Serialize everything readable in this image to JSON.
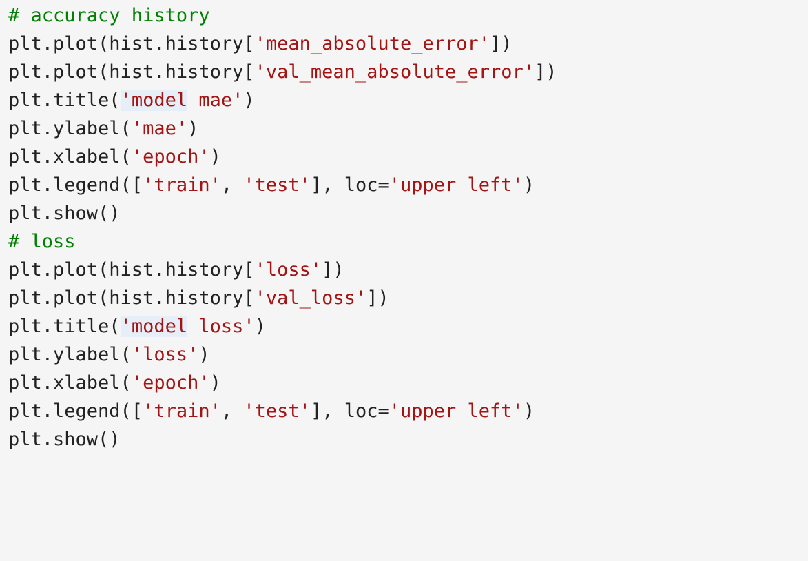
{
  "code": {
    "language": "python",
    "colors": {
      "background": "#f5f5f5",
      "plain": "#222222",
      "string": "#a31515",
      "comment": "#008000",
      "selection_highlight": "#e6eef8"
    },
    "lines": [
      [
        {
          "t": "comment",
          "v": "# accuracy history"
        }
      ],
      [
        {
          "t": "plain",
          "v": "plt.plot(hist.history["
        },
        {
          "t": "string",
          "v": "'mean_absolute_error'"
        },
        {
          "t": "plain",
          "v": "])"
        }
      ],
      [
        {
          "t": "plain",
          "v": "plt.plot(hist.history["
        },
        {
          "t": "string",
          "v": "'val_mean_absolute_error'"
        },
        {
          "t": "plain",
          "v": "])"
        }
      ],
      [
        {
          "t": "plain",
          "v": "plt.title("
        },
        {
          "t": "string",
          "v": "'model",
          "hl": true
        },
        {
          "t": "string",
          "v": " mae'"
        },
        {
          "t": "plain",
          "v": ")"
        }
      ],
      [
        {
          "t": "plain",
          "v": "plt.ylabel("
        },
        {
          "t": "string",
          "v": "'mae'"
        },
        {
          "t": "plain",
          "v": ")"
        }
      ],
      [
        {
          "t": "plain",
          "v": "plt.xlabel("
        },
        {
          "t": "string",
          "v": "'epoch'"
        },
        {
          "t": "plain",
          "v": ")"
        }
      ],
      [
        {
          "t": "plain",
          "v": "plt.legend(["
        },
        {
          "t": "string",
          "v": "'train'"
        },
        {
          "t": "plain",
          "v": ", "
        },
        {
          "t": "string",
          "v": "'test'"
        },
        {
          "t": "plain",
          "v": "], loc="
        },
        {
          "t": "string",
          "v": "'upper left'"
        },
        {
          "t": "plain",
          "v": ")"
        }
      ],
      [
        {
          "t": "plain",
          "v": "plt.show()"
        }
      ],
      [
        {
          "t": "comment",
          "v": "# loss"
        }
      ],
      [
        {
          "t": "plain",
          "v": "plt.plot(hist.history["
        },
        {
          "t": "string",
          "v": "'loss'"
        },
        {
          "t": "plain",
          "v": "])"
        }
      ],
      [
        {
          "t": "plain",
          "v": "plt.plot(hist.history["
        },
        {
          "t": "string",
          "v": "'val_loss'"
        },
        {
          "t": "plain",
          "v": "])"
        }
      ],
      [
        {
          "t": "plain",
          "v": "plt.title("
        },
        {
          "t": "string",
          "v": "'model",
          "hl": true
        },
        {
          "t": "string",
          "v": " loss'"
        },
        {
          "t": "plain",
          "v": ")"
        }
      ],
      [
        {
          "t": "plain",
          "v": "plt.ylabel("
        },
        {
          "t": "string",
          "v": "'loss'"
        },
        {
          "t": "plain",
          "v": ")"
        }
      ],
      [
        {
          "t": "plain",
          "v": "plt.xlabel("
        },
        {
          "t": "string",
          "v": "'epoch'"
        },
        {
          "t": "plain",
          "v": ")"
        }
      ],
      [
        {
          "t": "plain",
          "v": "plt.legend(["
        },
        {
          "t": "string",
          "v": "'train'"
        },
        {
          "t": "plain",
          "v": ", "
        },
        {
          "t": "string",
          "v": "'test'"
        },
        {
          "t": "plain",
          "v": "], loc="
        },
        {
          "t": "string",
          "v": "'upper left'"
        },
        {
          "t": "plain",
          "v": ")"
        }
      ],
      [
        {
          "t": "plain",
          "v": "plt.show()"
        }
      ]
    ]
  }
}
